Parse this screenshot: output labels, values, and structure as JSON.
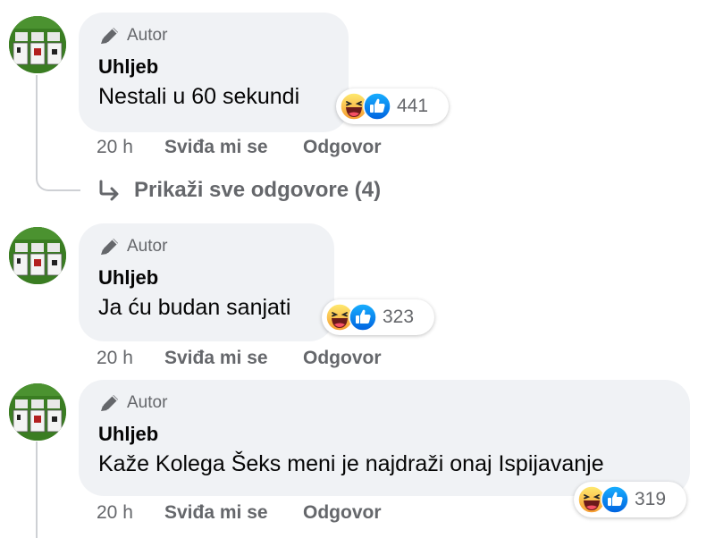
{
  "comments": [
    {
      "badge": "Autor",
      "author": "Uhljeb",
      "text": "Nestali u 60 sekundi",
      "reaction_count": "441",
      "time": "20 h",
      "like_label": "Sviđa mi se",
      "reply_label": "Odgovor",
      "show_replies": "Prikaži sve odgovore (4)"
    },
    {
      "badge": "Autor",
      "author": "Uhljeb",
      "text": "Ja ću budan sanjati",
      "reaction_count": "323",
      "time": "20 h",
      "like_label": "Sviđa mi se",
      "reply_label": "Odgovor"
    },
    {
      "badge": "Autor",
      "author": "Uhljeb",
      "text": "Kaže Kolega Šeks meni je najdraži onaj Ispijavanje",
      "reaction_count": "319",
      "time": "20 h",
      "like_label": "Sviđa mi se",
      "reply_label": "Odgovor"
    }
  ],
  "icons": {
    "badge": "pen-icon",
    "reaction_1": "haha-reaction-icon",
    "reaction_2": "like-reaction-icon",
    "show_replies": "reply-arrow-icon"
  },
  "colors": {
    "bubble": "#f0f2f5",
    "secondary_text": "#65676b",
    "like_blue": "#1877f2",
    "haha_yellow": "#f7b125"
  }
}
